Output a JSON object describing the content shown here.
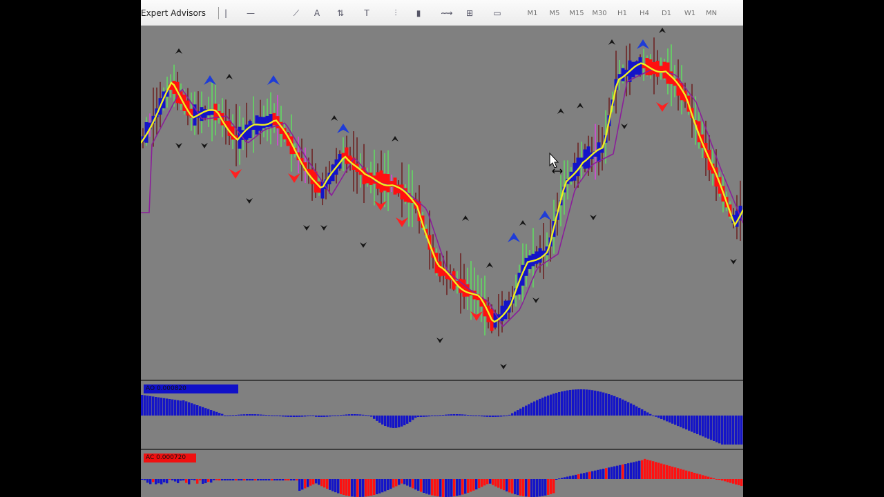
{
  "toolbar": {
    "expert_advisors_label": "Expert Advisors",
    "tools": [
      {
        "name": "vertical-line-icon",
        "glyph": "|"
      },
      {
        "name": "horizontal-line-icon",
        "glyph": "—"
      },
      {
        "name": "trendline-icon",
        "glyph": "⟋"
      },
      {
        "name": "text-tool-icon",
        "glyph": "A"
      },
      {
        "name": "arrows-tool-icon",
        "glyph": "⇅"
      },
      {
        "name": "text-label-icon",
        "glyph": "T"
      },
      {
        "name": "bar-chart-icon",
        "glyph": "⫶"
      },
      {
        "name": "candlestick-icon",
        "glyph": "▮"
      },
      {
        "name": "line-chart-icon",
        "glyph": "⟿"
      },
      {
        "name": "zoom-in-icon",
        "glyph": "⊞"
      },
      {
        "name": "chart-template-icon",
        "glyph": "▭"
      }
    ],
    "timeframes": [
      "M1",
      "M5",
      "M15",
      "M30",
      "H1",
      "H4",
      "D1",
      "W1",
      "MN"
    ]
  },
  "main_chart": {
    "colors": {
      "bull": "#1414c8",
      "bear": "#ff1010",
      "yellow": "#f0f020",
      "purple": "#8a1e9a",
      "green_wick": "#60e060",
      "pink_wick": "#e040e0",
      "dark_wick": "#6b1e1e",
      "arrow_dark": "#151515",
      "arrow_blue": "#1e3cd8",
      "arrow_red": "#ff2020"
    }
  },
  "oscillator_1": {
    "label": "AO  0.000820",
    "bar_color": "#1414c8"
  },
  "oscillator_2": {
    "label": "AC  0.000720",
    "up_color": "#1414c8",
    "down_color": "#ff1010"
  }
}
